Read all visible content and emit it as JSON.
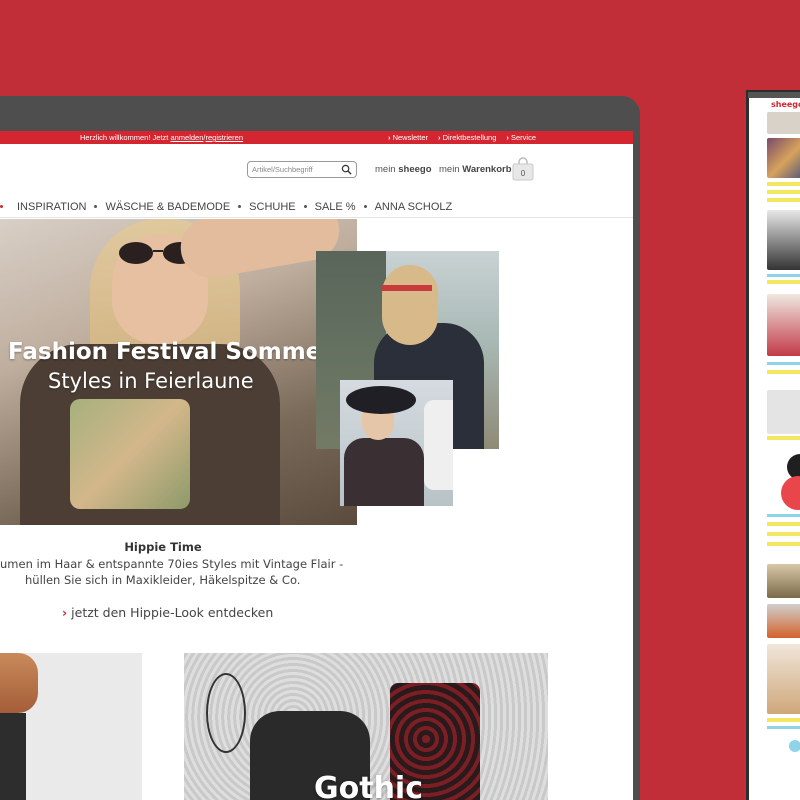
{
  "topbar": {
    "welcome_prefix": "Herzlich willkommen! Jetzt",
    "login": "anmelden",
    "sep": "/",
    "register": "registrieren",
    "links": [
      "Newsletter",
      "Direktbestellung",
      "Service"
    ]
  },
  "header": {
    "search_placeholder": "Artikel/Suchbegriff",
    "account_prefix": "mein",
    "account_brand": "sheego",
    "cart_prefix": "mein",
    "cart_label": "Warenkorb",
    "cart_count": "0"
  },
  "nav": {
    "items": [
      "INSPIRATION",
      "WÄSCHE & BADEMODE",
      "SCHUHE",
      "SALE %",
      "ANNA SCHOLZ"
    ]
  },
  "hero": {
    "title": "Fashion Festival Sommer",
    "subtitle": "Styles in Feierlaune"
  },
  "teaser": {
    "title": "Hippie Time",
    "line1": "umen im Haar & entspannte 70ies Styles mit Vintage Flair -",
    "line2": "hüllen Sie sich in Maxikleider, Häkelspitze & Co.",
    "cta": "jetzt den Hippie-Look entdecken"
  },
  "tiles": {
    "gothic_label": "Gothic"
  },
  "mobile": {
    "logo": "sheego"
  },
  "colors": {
    "background": "#c12e38",
    "brand_red": "#d42630",
    "device_frame": "#4e4e4e"
  },
  "icons": [
    "search-icon",
    "shopping-bag-icon",
    "chevron-right-icon"
  ]
}
